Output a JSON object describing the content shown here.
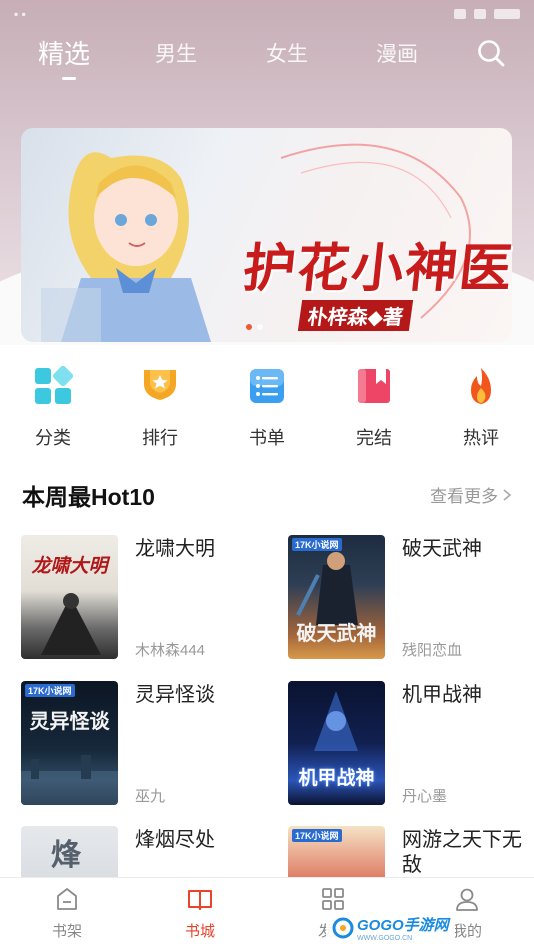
{
  "nav": {
    "tabs": [
      {
        "label": "精选",
        "active": true
      },
      {
        "label": "男生",
        "active": false
      },
      {
        "label": "女生",
        "active": false
      },
      {
        "label": "漫画",
        "active": false
      }
    ],
    "search_icon": "search-icon"
  },
  "banner": {
    "title": "护花小神医",
    "subtitle": "朴梓森◆著",
    "slide_count": 2,
    "active_slide": 1
  },
  "quick_links": [
    {
      "label": "分类",
      "icon": "category-grid-icon",
      "color": "#3cc9df"
    },
    {
      "label": "排行",
      "icon": "trophy-icon",
      "color": "#f5a623"
    },
    {
      "label": "书单",
      "icon": "book-list-icon",
      "color": "#3a9ff0"
    },
    {
      "label": "完结",
      "icon": "bookmark-book-icon",
      "color": "#ee4567"
    },
    {
      "label": "热评",
      "icon": "flame-icon",
      "color": "#f2561d"
    }
  ],
  "section": {
    "title": "本周最Hot10",
    "more_label": "查看更多"
  },
  "books": [
    {
      "title": "龙啸大明",
      "author": "木林森444",
      "cover_text": "龙啸大明",
      "cover_colors": [
        "#e9e6df",
        "#3a3a3a"
      ]
    },
    {
      "title": "破天武神",
      "author": "残阳恋血",
      "cover_text": "破天武神",
      "cover_colors": [
        "#1c2a3c",
        "#c7803c"
      ]
    },
    {
      "title": "灵异怪谈",
      "author": "巫九",
      "cover_text": "灵异怪谈",
      "cover_colors": [
        "#0e1a2a",
        "#3f5f7a"
      ]
    },
    {
      "title": "机甲战神",
      "author": "丹心墨",
      "cover_text": "机甲战神",
      "cover_colors": [
        "#0d1838",
        "#2c55b8"
      ]
    },
    {
      "title": "烽烟尽处",
      "author": "",
      "cover_text": "烽",
      "cover_colors": [
        "#dfe3e6",
        "#8d96a0"
      ]
    },
    {
      "title": "网游之天下无敌",
      "author": "",
      "cover_text": "",
      "cover_colors": [
        "#f7e3c8",
        "#b71d16"
      ]
    }
  ],
  "cover_tag": "17K小说网",
  "bottom_tabs": [
    {
      "label": "书架",
      "icon": "bookshelf-icon",
      "active": false
    },
    {
      "label": "书城",
      "icon": "open-book-icon",
      "active": true
    },
    {
      "label": "发现",
      "icon": "grid-icon",
      "active": false
    },
    {
      "label": "我的",
      "icon": "user-icon",
      "active": false
    }
  ],
  "watermark": {
    "logo": "GOGO手游网",
    "url": "WWW.GOGO.CN"
  },
  "colors": {
    "accent": "#e8432b",
    "header_bg": "#c7aeb7"
  }
}
